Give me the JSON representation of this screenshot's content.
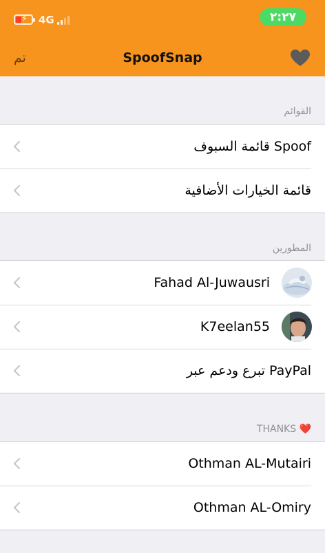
{
  "status_bar": {
    "network": "4G",
    "time": "٢:٢٧",
    "battery_icon": "battery-low-charging-icon",
    "signal_icon": "signal-bars-icon"
  },
  "nav": {
    "done_label": "تم",
    "title": "SpoofSnap",
    "favorite_icon": "heart-icon"
  },
  "sections": {
    "lists": {
      "header": "القوائم",
      "items": [
        {
          "label": "قائمة السبوف Spoof"
        },
        {
          "label": "قائمة الخيارات الأضافية"
        }
      ]
    },
    "developers": {
      "header": "المطورين",
      "items": [
        {
          "label": "Fahad Al-Juwausri",
          "avatar": "avatar-photo"
        },
        {
          "label": "K7eelan55",
          "avatar": "avatar-photo"
        },
        {
          "label": "تبرع ودعم عبر PayPal"
        }
      ]
    },
    "thanks": {
      "header": "THANKS ❤️",
      "items": [
        {
          "label": "Othman AL-Mutairi"
        },
        {
          "label": "Othman AL-Omiry"
        }
      ]
    }
  },
  "colors": {
    "header_bg": "#f7941d",
    "time_pill": "#4cd964",
    "page_bg": "#efeff4"
  }
}
